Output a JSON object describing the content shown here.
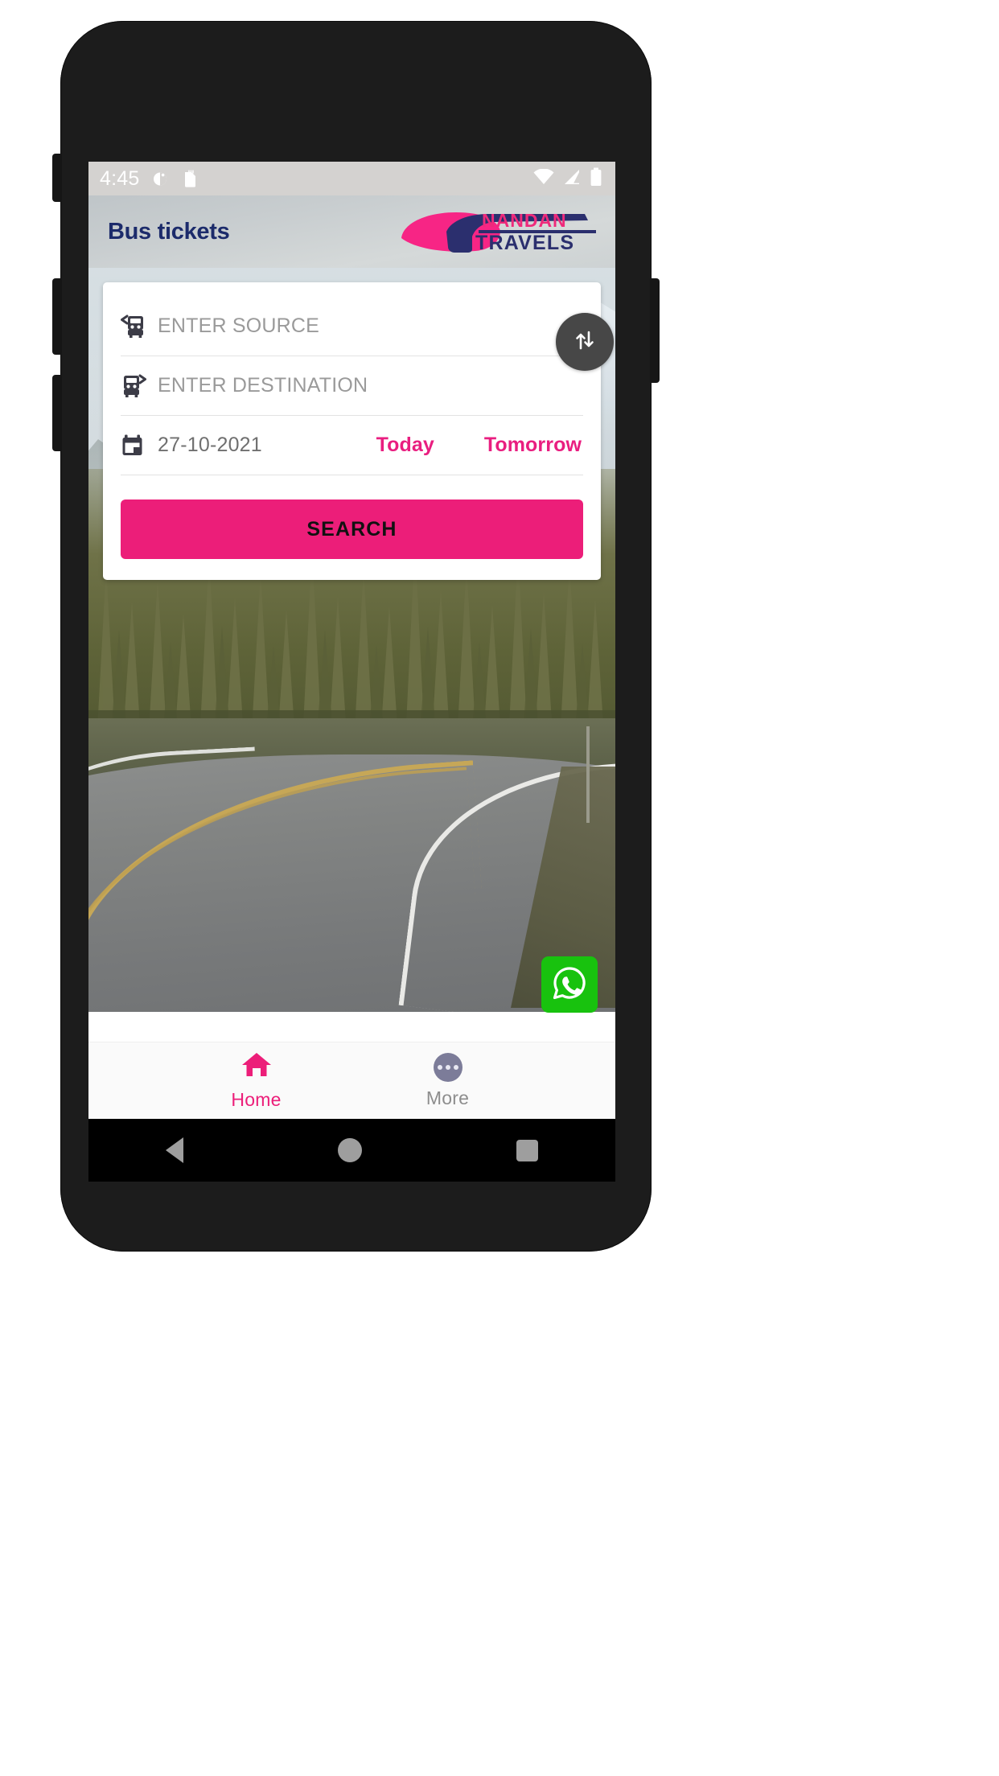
{
  "status_bar": {
    "time": "4:45",
    "left_icons": [
      "alarm-icon",
      "sd-card-icon"
    ],
    "right_icons": [
      "wifi-icon",
      "signal-icon",
      "battery-icon"
    ]
  },
  "header": {
    "title": "Bus tickets",
    "title_color": "#1c2b6b",
    "logo": {
      "line1": "NANDAN",
      "line2": "TRAVELS",
      "swoosh_color": "#f72585",
      "text_color_line1": "#ee2a7b",
      "text_color_line2": "#2b2f6e"
    }
  },
  "search_card": {
    "source": {
      "icon": "bus-departure-icon",
      "placeholder": "ENTER SOURCE",
      "value": ""
    },
    "destination": {
      "icon": "bus-arrival-icon",
      "placeholder": "ENTER DESTINATION",
      "value": ""
    },
    "swap_button": {
      "icon": "swap-vertical-icon",
      "color": "#474747"
    },
    "date": {
      "icon": "calendar-icon",
      "value": "27-10-2021",
      "today_label": "Today",
      "tomorrow_label": "Tomorrow",
      "quick_color": "#e91e80"
    },
    "search_button": {
      "label": "SEARCH",
      "background": "#ec1e79",
      "text_color": "#111111"
    }
  },
  "floating_action": {
    "whatsapp": {
      "icon": "whatsapp-icon",
      "background": "#18c20e"
    }
  },
  "bottom_nav": {
    "items": [
      {
        "label": "Home",
        "icon": "home-icon",
        "active": true,
        "color": "#ec1e79"
      },
      {
        "label": "More",
        "icon": "more-dots-icon",
        "active": false,
        "color": "#8d8d8d"
      }
    ]
  },
  "system_nav": {
    "back": "back-triangle-icon",
    "home": "home-circle-icon",
    "recents": "recents-square-icon"
  },
  "scene": {
    "description": "mountain-road-photo"
  }
}
